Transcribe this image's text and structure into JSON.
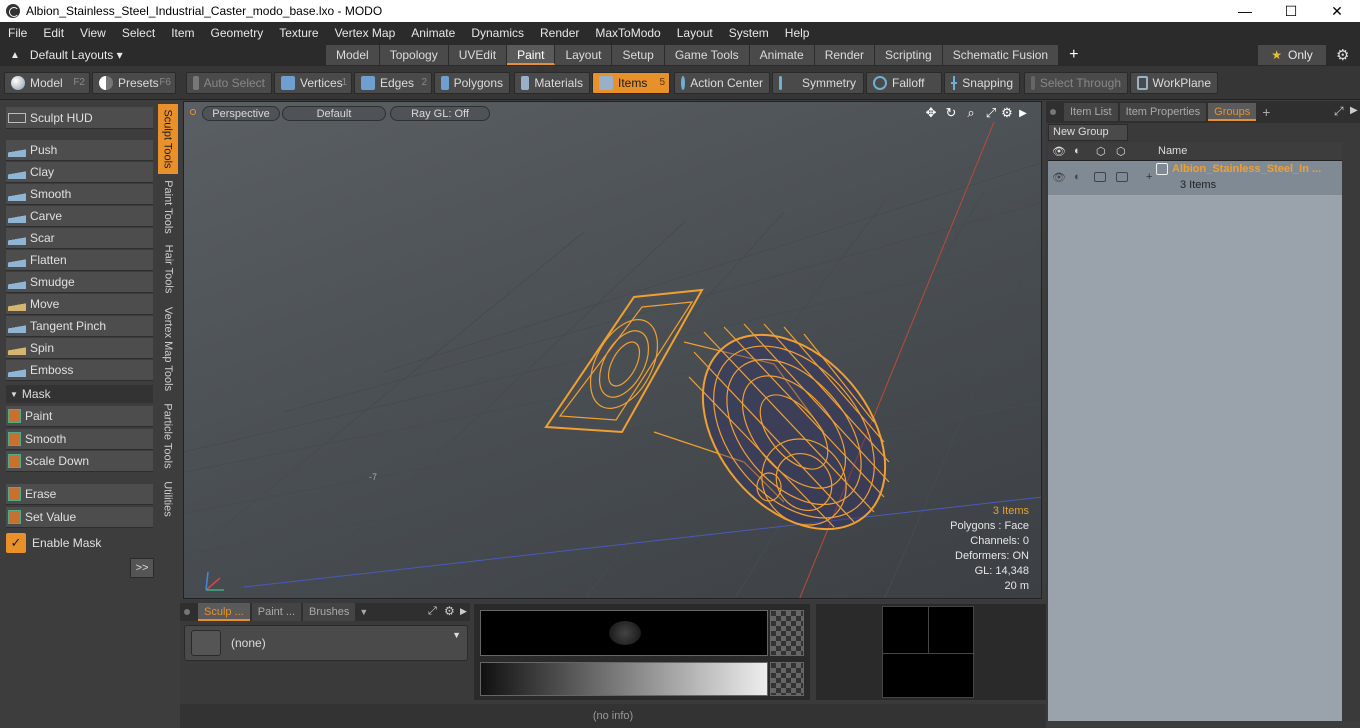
{
  "window": {
    "title": "Albion_Stainless_Steel_Industrial_Caster_modo_base.lxo - MODO",
    "minimize": "—",
    "maximize": "☐",
    "close": "✕"
  },
  "menu": [
    "File",
    "Edit",
    "View",
    "Select",
    "Item",
    "Geometry",
    "Texture",
    "Vertex Map",
    "Animate",
    "Dynamics",
    "Render",
    "MaxToModo",
    "Layout",
    "System",
    "Help"
  ],
  "layouts": {
    "label": "Default Layouts ▾",
    "tabs": [
      "Model",
      "Topology",
      "UVEdit",
      "Paint",
      "Layout",
      "Setup",
      "Game Tools",
      "Animate",
      "Render",
      "Scripting",
      "Schematic Fusion"
    ],
    "active": "Paint",
    "add": "+",
    "only": "Only"
  },
  "toolbar": {
    "model": "Model",
    "model_key": "F2",
    "presets": "Presets",
    "presets_key": "F6",
    "auto_select": "Auto Select",
    "vertices": "Vertices",
    "vertices_key": "1",
    "edges": "Edges",
    "edges_key": "2",
    "polygons": "Polygons",
    "materials": "Materials",
    "items": "Items",
    "items_key": "5",
    "action_center": "Action Center",
    "symmetry": "Symmetry",
    "falloff": "Falloff",
    "snapping": "Snapping",
    "select_through": "Select Through",
    "workplane": "WorkPlane"
  },
  "sculpt": {
    "hud": "Sculpt HUD",
    "tools": [
      "Push",
      "Clay",
      "Smooth",
      "Carve",
      "Scar",
      "Flatten",
      "Smudge",
      "Move",
      "Tangent Pinch",
      "Spin",
      "Emboss"
    ],
    "mask_header": "Mask",
    "mask_tools": [
      "Paint",
      "Smooth",
      "Scale Down"
    ],
    "erase": "Erase",
    "set_value": "Set Value",
    "enable_mask": "Enable Mask",
    "more": ">>"
  },
  "vtabs": [
    "Sculpt Tools",
    "Paint Tools",
    "Hair Tools",
    "Vertex Map Tools",
    "Particle Tools",
    "Utilities"
  ],
  "viewport": {
    "perspective": "Perspective",
    "default": "Default",
    "raygl": "Ray GL: Off",
    "axis_num": "-7",
    "stats": {
      "items": "3 Items",
      "polygons": "Polygons : Face",
      "channels": "Channels: 0",
      "deformers": "Deformers: ON",
      "gl": "GL: 14,348",
      "distance": "20 m"
    }
  },
  "right": {
    "tabs": [
      "Item List",
      "Item Properties",
      "Groups"
    ],
    "active": "Groups",
    "add": "+",
    "new_group": "New Group",
    "col_name": "Name",
    "group_name": "Albion_Stainless_Steel_In ...",
    "group_count": "3 Items"
  },
  "bottom": {
    "tabs": [
      "Sculp ...",
      "Paint ...",
      "Brushes"
    ],
    "brush": "(none)"
  },
  "status": "(no info)",
  "colors": {
    "accent": "#e8912b",
    "wire": "#f0a030"
  }
}
